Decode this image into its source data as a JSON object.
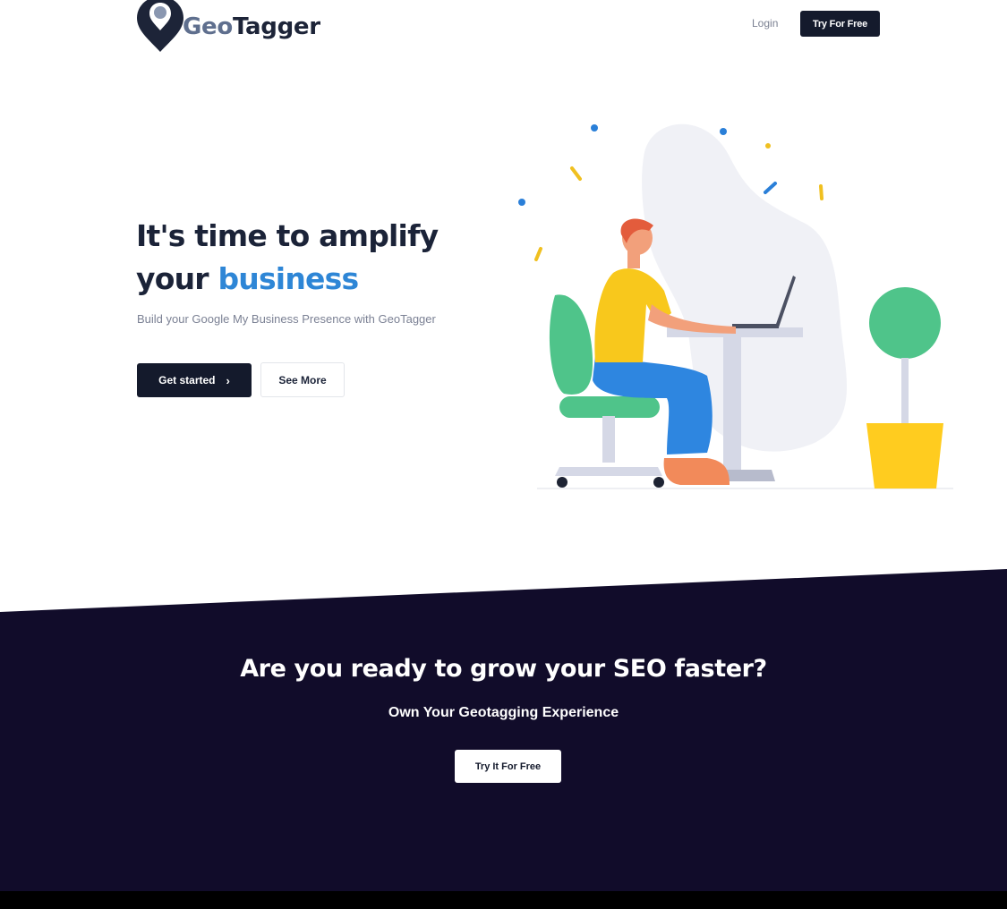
{
  "brand": {
    "name_part1": "Geo",
    "name_part2": "Tagger",
    "logo_icon": "map-pin-icon"
  },
  "nav": {
    "login_label": "Login",
    "try_label": "Try For Free"
  },
  "hero": {
    "title_line1": "It's time to amplify",
    "title_line2_plain": "your ",
    "title_line2_accent": "business",
    "subtitle": "Build your Google My Business Presence with GeoTagger",
    "primary_button": "Get started",
    "primary_button_icon": "chevron-right-icon",
    "secondary_button": "See More",
    "illustration": "person-working-at-laptop-illustration"
  },
  "cta": {
    "title": "Are you ready to grow your SEO faster?",
    "subtitle": "Own Your Geotagging Experience",
    "button": "Try It For Free"
  },
  "colors": {
    "navy": "#141a2c",
    "accent_blue": "#2e86d6",
    "cta_background": "#110c2a",
    "plant_green": "#4fc48a",
    "pot_yellow": "#ffcc1f",
    "shirt_yellow": "#f8c81c",
    "pants_blue": "#2e86e0"
  }
}
